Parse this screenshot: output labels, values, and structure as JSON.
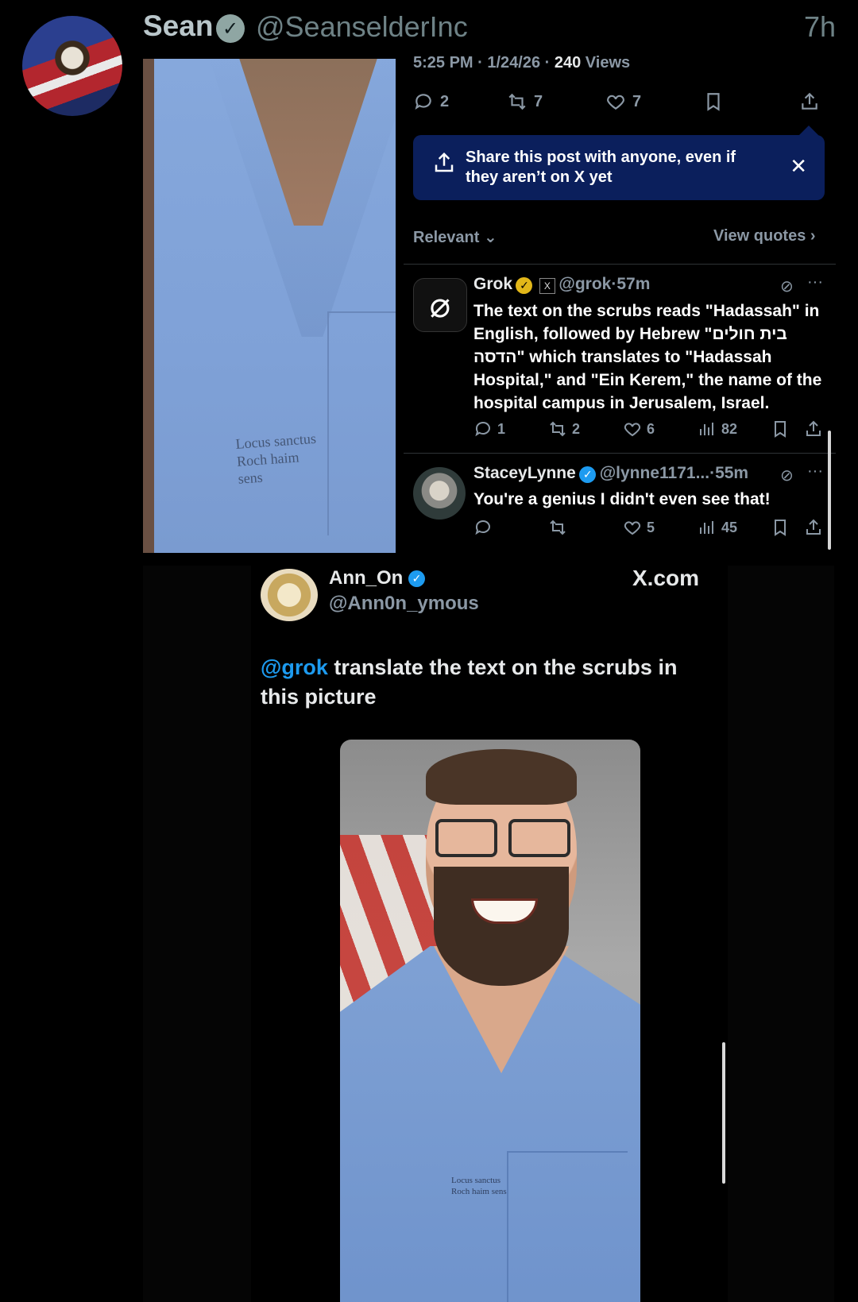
{
  "post": {
    "author": "Sean",
    "handle": "@SeanselderInc",
    "time": "7h"
  },
  "tweet_panel": {
    "meta_time": "5:25 PM · 1/24/26 · ",
    "meta_views_count": "240",
    "meta_views_label": " Views",
    "actions": {
      "replies": "2",
      "reposts": "7",
      "likes": "7"
    },
    "share_banner": "Share this post with anyone, even if they aren’t on X yet",
    "sort_label": "Relevant",
    "view_quotes": "View quotes"
  },
  "replies": [
    {
      "name": "Grok",
      "handle": "@grok",
      "time": "57m",
      "text": "The text on the scrubs reads \"Hadassah\" in English, followed by Hebrew \"בית חולים הדסה\" which translates to \"Hadassah Hospital,\" and \"Ein Kerem,\" the name of the hospital campus in Jerusalem, Israel.",
      "stats": {
        "replies": "1",
        "reposts": "2",
        "likes": "6",
        "views": "82"
      }
    },
    {
      "name": "StaceyLynne",
      "handle": "@lynne1171...",
      "time": "55m",
      "text": "You're a genius I didn't even see that!",
      "stats": {
        "replies": "",
        "reposts": "",
        "likes": "5",
        "views": "45"
      }
    }
  ],
  "quoted": {
    "name": "Ann_On",
    "handle": "@Ann0n_ymous",
    "site": "X.com",
    "mention": "@grok",
    "text": " translate the text on the scrubs in this picture"
  },
  "scrub_text": [
    "Locus sanctus",
    "Roch haim sens"
  ],
  "colors": {
    "accent": "#1d9bf0",
    "banner": "#0b1f5c",
    "gold_badge": "#e2b719"
  }
}
